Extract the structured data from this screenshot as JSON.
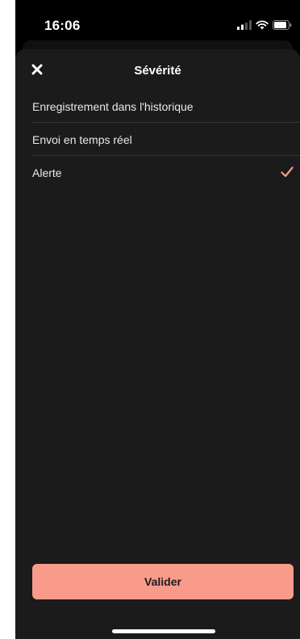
{
  "status_bar": {
    "time": "16:06",
    "icons": [
      "cellular-signal-icon",
      "wifi-icon",
      "battery-icon"
    ]
  },
  "sheet": {
    "title": "Sévérité",
    "close_icon": "close-icon",
    "options": [
      {
        "label": "Enregistrement dans l'historique",
        "selected": false
      },
      {
        "label": "Envoi en temps réel",
        "selected": false
      },
      {
        "label": "Alerte",
        "selected": true
      }
    ],
    "validate_label": "Valider"
  },
  "colors": {
    "accent": "#f89b8b",
    "sheet_bg": "#1b1b1b",
    "background": "#000000",
    "text": "#e9e9e9"
  }
}
